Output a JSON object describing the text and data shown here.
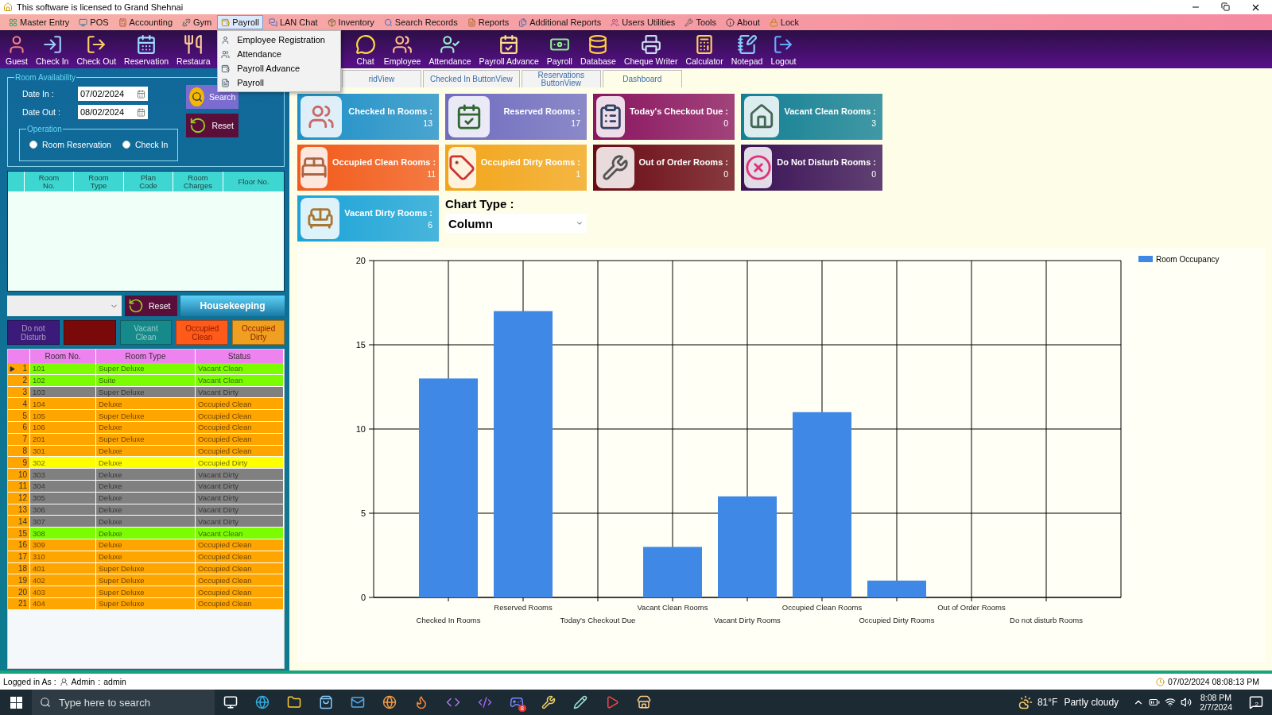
{
  "window": {
    "title": "This software is licensed to Grand Shehnai"
  },
  "menu": [
    {
      "label": "Master Entry",
      "selected": false
    },
    {
      "label": "POS",
      "selected": false
    },
    {
      "label": "Accounting",
      "selected": false
    },
    {
      "label": "Gym",
      "selected": false
    },
    {
      "label": "Payroll",
      "selected": true
    },
    {
      "label": "LAN Chat",
      "selected": false
    },
    {
      "label": "Inventory",
      "selected": false
    },
    {
      "label": "Search Records",
      "selected": false
    },
    {
      "label": "Reports",
      "selected": false
    },
    {
      "label": "Additional Reports",
      "selected": false
    },
    {
      "label": "Users Utilities",
      "selected": false
    },
    {
      "label": "Tools",
      "selected": false
    },
    {
      "label": "About",
      "selected": false
    },
    {
      "label": "Lock",
      "selected": false
    }
  ],
  "payroll_menu": [
    "Employee Registration",
    "Attendance",
    "Payroll Advance",
    "Payroll"
  ],
  "toolbar_left": [
    "Guest",
    "Check In",
    "Check Out",
    "Reservation",
    "Restaura"
  ],
  "toolbar_right": [
    "Chat",
    "Employee",
    "Attendance",
    "Payroll Advance",
    "Payroll",
    "Database",
    "Cheque Writer",
    "Calculator",
    "Notepad",
    "Logout"
  ],
  "room_availability": {
    "title": "Room Availability",
    "date_in": {
      "label": "Date In :",
      "value": "07/02/2024"
    },
    "date_out": {
      "label": "Date Out :",
      "value": "08/02/2024"
    },
    "search_button": "Search",
    "reset_button": "Reset",
    "operation": {
      "title": "Operation",
      "options": [
        {
          "label": "Room Reservation",
          "selected": false
        },
        {
          "label": "Check In",
          "selected": false
        }
      ]
    }
  },
  "availability_table": {
    "columns": [
      "Room\nNo.",
      "Room\nType",
      "Plan\nCode",
      "Room\nCharges",
      "Floor No."
    ]
  },
  "housekeeping": {
    "reset_button": "Reset",
    "housekeeping_button": "Housekeeping",
    "filters": [
      {
        "label": "Do not\nDisturb",
        "color": "#3b1a7a"
      },
      {
        "color": "#7a0a0a"
      },
      {
        "label": "Vacant\nClean",
        "color": "#168a8a"
      },
      {
        "label": "Occupied\nClean",
        "color": "#ff5a1a"
      },
      {
        "label": "Occupied\nDirty",
        "color": "#f0a020"
      }
    ]
  },
  "rooms_table": {
    "columns": [
      "Room No.",
      "Room Type",
      "Status"
    ],
    "rows": [
      {
        "index": "1",
        "room": "101",
        "type": "Super Deluxe",
        "status": "Vacant Clean",
        "color": "#7cfc00",
        "selected": true
      },
      {
        "index": "2",
        "room": "102",
        "type": "Suite",
        "status": "Vacant Clean",
        "color": "#7cfc00",
        "selected": false
      },
      {
        "index": "3",
        "room": "103",
        "type": "Super Deluxe",
        "status": "Vacant Dirty",
        "color": "#808080",
        "selected": false
      },
      {
        "index": "4",
        "room": "104",
        "type": "Deluxe",
        "status": "Occupied Clean",
        "color": "#ffa500",
        "selected": false
      },
      {
        "index": "5",
        "room": "105",
        "type": "Super Deluxe",
        "status": "Occupied Clean",
        "color": "#ffa500",
        "selected": false
      },
      {
        "index": "6",
        "room": "106",
        "type": "Deluxe",
        "status": "Occupied Clean",
        "color": "#ffa500",
        "selected": false
      },
      {
        "index": "7",
        "room": "201",
        "type": "Super Deluxe",
        "status": "Occupied Clean",
        "color": "#ffa500",
        "selected": false
      },
      {
        "index": "8",
        "room": "301",
        "type": "Deluxe",
        "status": "Occupied Clean",
        "color": "#ffa500",
        "selected": false
      },
      {
        "index": "9",
        "room": "302",
        "type": "Deluxe",
        "status": "Occupied Dirty",
        "color": "#ffff00",
        "selected": false
      },
      {
        "index": "10",
        "room": "303",
        "type": "Deluxe",
        "status": "Vacant Dirty",
        "color": "#808080",
        "selected": false
      },
      {
        "index": "11",
        "room": "304",
        "type": "Deluxe",
        "status": "Vacant Dirty",
        "color": "#808080",
        "selected": false
      },
      {
        "index": "12",
        "room": "305",
        "type": "Deluxe",
        "status": "Vacant Dirty",
        "color": "#808080",
        "selected": false
      },
      {
        "index": "13",
        "room": "306",
        "type": "Deluxe",
        "status": "Vacant Dirty",
        "color": "#808080",
        "selected": false
      },
      {
        "index": "14",
        "room": "307",
        "type": "Deluxe",
        "status": "Vacant Dirty",
        "color": "#808080",
        "selected": false
      },
      {
        "index": "15",
        "room": "308",
        "type": "Deluxe",
        "status": "Vacant Clean",
        "color": "#7cfc00",
        "selected": false
      },
      {
        "index": "16",
        "room": "309",
        "type": "Deluxe",
        "status": "Occupied Clean",
        "color": "#ffa500",
        "selected": false
      },
      {
        "index": "17",
        "room": "310",
        "type": "Deluxe",
        "status": "Occupied Clean",
        "color": "#ffa500",
        "selected": false
      },
      {
        "index": "18",
        "room": "401",
        "type": "Super Deluxe",
        "status": "Occupied Clean",
        "color": "#ffa500",
        "selected": false
      },
      {
        "index": "19",
        "room": "402",
        "type": "Super Deluxe",
        "status": "Occupied Clean",
        "color": "#ffa500",
        "selected": false
      },
      {
        "index": "20",
        "room": "403",
        "type": "Super Deluxe",
        "status": "Occupied Clean",
        "color": "#ffa500",
        "selected": false
      },
      {
        "index": "21",
        "room": "404",
        "type": "Super Deluxe",
        "status": "Occupied Clean",
        "color": "#ffa500",
        "selected": false
      }
    ]
  },
  "tabs": [
    {
      "label": "ridView",
      "selected": false
    },
    {
      "label": "Checked In ButtonView",
      "selected": false
    },
    {
      "label": "Reservations\nButtonView",
      "selected": false
    },
    {
      "label": "Dashboard",
      "selected": true
    }
  ],
  "cards": [
    {
      "title": "Checked In Rooms :",
      "value": "13",
      "color": "#1e8fc8"
    },
    {
      "title": "Reserved Rooms :",
      "value": "17",
      "color": "#6f6cc0"
    },
    {
      "title": "Today's Checkout Due :",
      "value": "0",
      "color": "#8a1560"
    },
    {
      "title": "Vacant Clean Rooms :",
      "value": "3",
      "color": "#137f94"
    },
    {
      "title": "Occupied Clean Rooms :",
      "value": "11",
      "color": "#f25a1a"
    },
    {
      "title": "Occupied Dirty Rooms :",
      "value": "1",
      "color": "#f2a51a"
    },
    {
      "title": "Out of Order Rooms :",
      "value": "0",
      "color": "#6a0a14"
    },
    {
      "title": "Do Not Disturb Rooms :",
      "value": "0",
      "color": "#3a1256"
    },
    {
      "title": "Vacant Dirty Rooms :",
      "value": "6",
      "color": "#1ba3d8"
    }
  ],
  "chart_type": {
    "label": "Chart Type :",
    "value": "Column"
  },
  "chart": {
    "chart_data": {
      "type": "bar",
      "categories": [
        "Checked In Rooms",
        "Reserved Rooms",
        "Today's Checkout Due",
        "Vacant Clean Rooms",
        "Vacant Dirty Rooms",
        "Occupied Clean Rooms",
        "Occupied Dirty Rooms",
        "Out of Order Rooms",
        "Do not disturb Rooms"
      ],
      "series": [
        {
          "name": "Room Occupancy",
          "color": "#3f88e6",
          "values": [
            13,
            17,
            0,
            3,
            6,
            11,
            1,
            0,
            0
          ]
        }
      ],
      "ylim": [
        0,
        20
      ],
      "yticks": [
        0,
        5,
        10,
        15,
        20
      ],
      "grid": true
    }
  },
  "status_bar": {
    "logged_label": "Logged in As :",
    "user": "Admin",
    "separator": ":",
    "login": "admin",
    "datetime": "07/02/2024 08:08:13 PM"
  },
  "taskbar": {
    "search": {
      "placeholder": "Type here to search"
    },
    "chat_badge": "8",
    "temperature": "81°F",
    "condition": "Partly cloudy",
    "time": "8:08 PM",
    "date": "2/7/2024",
    "notifications": "2"
  }
}
